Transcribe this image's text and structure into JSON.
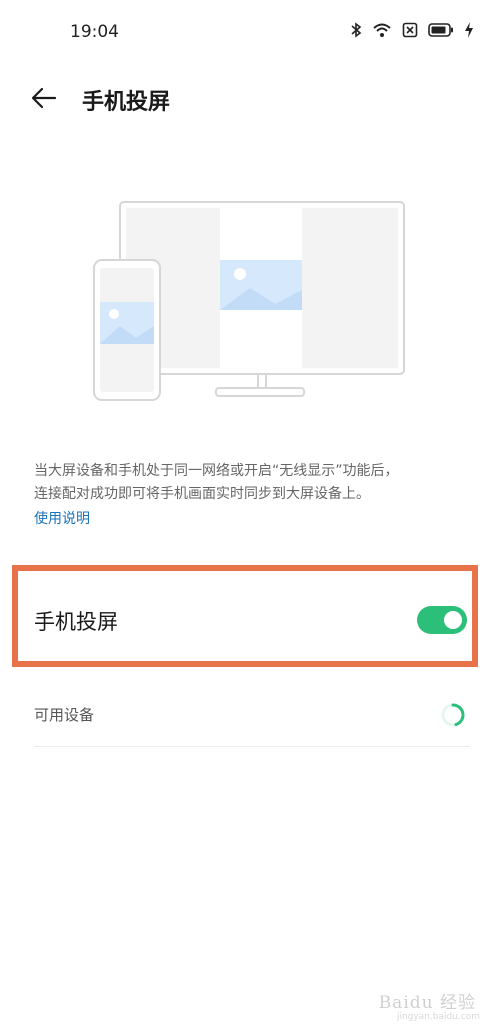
{
  "status_bar": {
    "time": "19:04",
    "icons": [
      "bluetooth-icon",
      "wifi-icon",
      "sim-icon",
      "battery-icon",
      "charging-icon"
    ]
  },
  "header": {
    "back_icon": "arrow-left-icon",
    "title": "手机投屏"
  },
  "description": {
    "line1": "当大屏设备和手机处于同一网络或开启“无线显示”功能后，",
    "line2": "连接配对成功即可将手机画面实时同步到大屏设备上。",
    "help_link": "使用说明"
  },
  "toggle": {
    "label": "手机投屏",
    "state": "on"
  },
  "devices": {
    "label": "可用设备",
    "loading_icon": "spinner-icon"
  },
  "watermark": {
    "text": "Baidu 经验",
    "sub": "jingyan.baidu.com"
  },
  "colors": {
    "accent_green": "#2bbf7a",
    "highlight_orange": "#e8734a",
    "link_blue": "#1a73b8"
  }
}
